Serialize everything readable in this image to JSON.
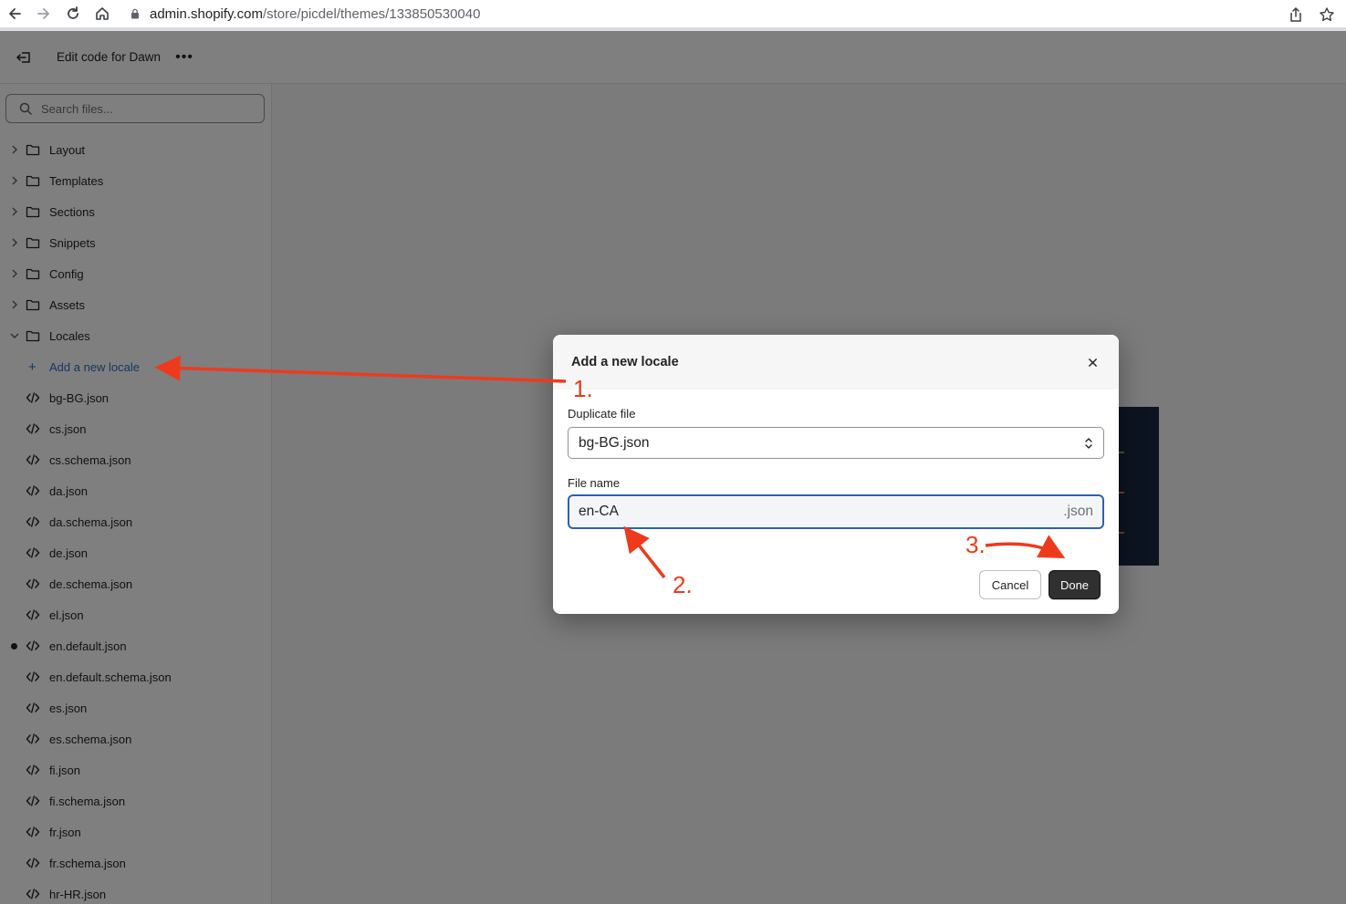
{
  "browser": {
    "url_host": "admin.shopify.com",
    "url_path": "/store/picdel/themes/133850530040"
  },
  "topbar": {
    "title": "Edit code for Dawn"
  },
  "search": {
    "placeholder": "Search files..."
  },
  "folders": [
    {
      "label": "Layout"
    },
    {
      "label": "Templates"
    },
    {
      "label": "Sections"
    },
    {
      "label": "Snippets"
    },
    {
      "label": "Config"
    },
    {
      "label": "Assets"
    },
    {
      "label": "Locales"
    }
  ],
  "locales": {
    "add_label": "Add a new locale",
    "files": [
      {
        "label": "bg-BG.json"
      },
      {
        "label": "cs.json"
      },
      {
        "label": "cs.schema.json"
      },
      {
        "label": "da.json"
      },
      {
        "label": "da.schema.json"
      },
      {
        "label": "de.json"
      },
      {
        "label": "de.schema.json"
      },
      {
        "label": "el.json"
      },
      {
        "label": "en.default.json",
        "modified": true
      },
      {
        "label": "en.default.schema.json"
      },
      {
        "label": "es.json"
      },
      {
        "label": "es.schema.json"
      },
      {
        "label": "fi.json"
      },
      {
        "label": "fi.schema.json"
      },
      {
        "label": "fr.json"
      },
      {
        "label": "fr.schema.json"
      },
      {
        "label": "hr-HR.json"
      }
    ]
  },
  "modal": {
    "title": "Add a new locale",
    "duplicate_label": "Duplicate file",
    "duplicate_value": "bg-BG.json",
    "filename_label": "File name",
    "filename_value": "en-CA",
    "filename_suffix": ".json",
    "cancel_label": "Cancel",
    "done_label": "Done"
  },
  "annotations": {
    "step1": "1.",
    "step2": "2.",
    "step3": "3.",
    "color": "#ee3a1c"
  }
}
